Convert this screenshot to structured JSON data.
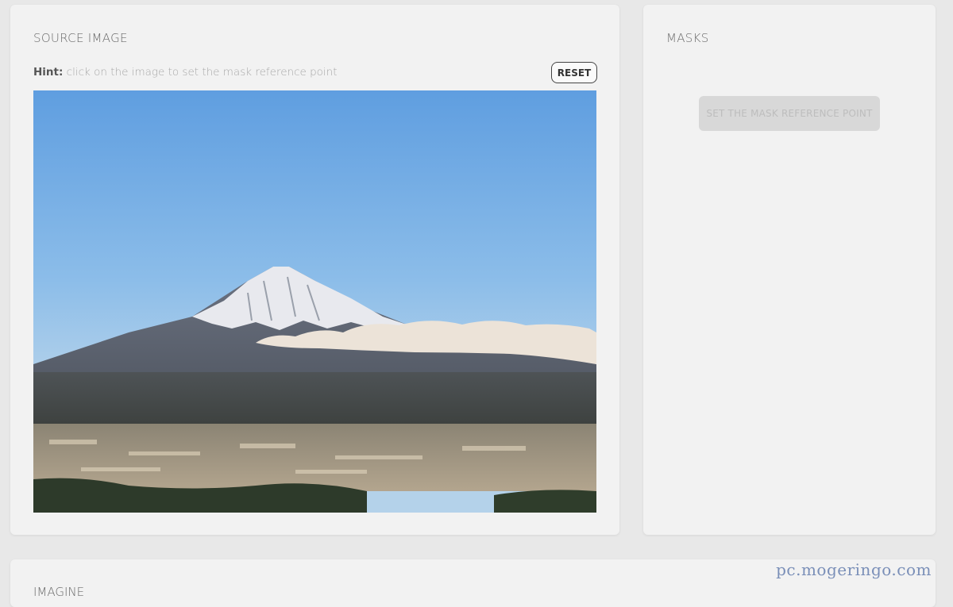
{
  "source_panel": {
    "title": "SOURCE IMAGE",
    "hint_label": "Hint:",
    "hint_text": " click on the image to set the mask reference point",
    "reset_label": "RESET",
    "image_subject": "mountain-landscape-photo"
  },
  "masks_panel": {
    "title": "MASKS",
    "set_point_label": "SET THE MASK REFERENCE POINT"
  },
  "bottom_panel": {
    "title": "IMAGINE"
  },
  "watermark": "pc.mogeringo.com",
  "colors": {
    "panel_bg": "#f2f2f2",
    "page_bg": "#e8e8e8",
    "disabled_button": "#d8d8d8"
  }
}
